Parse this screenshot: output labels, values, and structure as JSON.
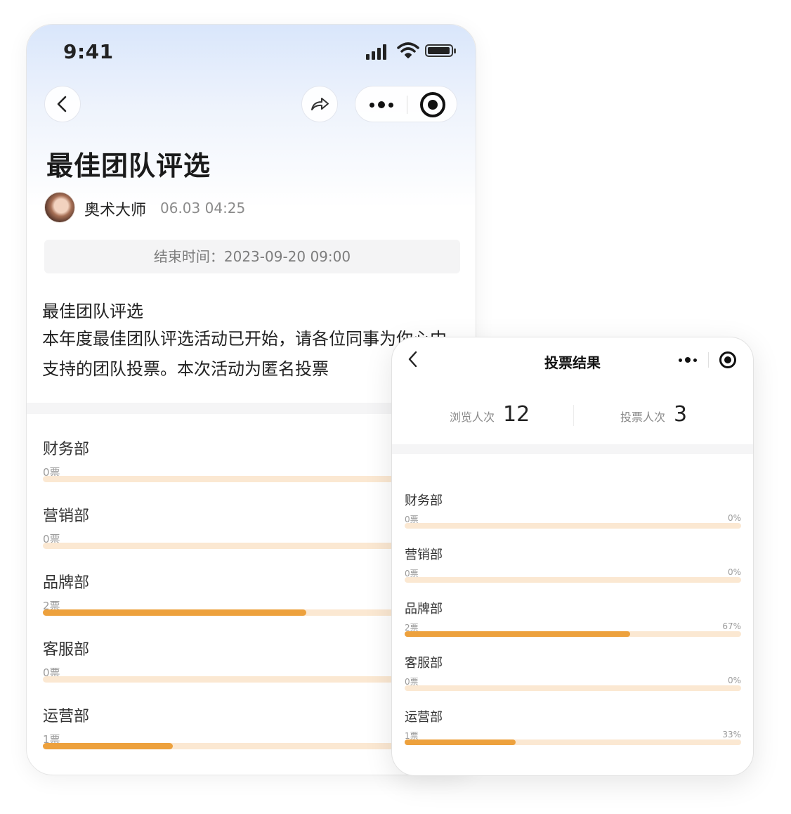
{
  "phone1": {
    "status": {
      "time": "9:41"
    },
    "title": "最佳团队评选",
    "author": "奥术大师",
    "post_time": "06.03 04:25",
    "end_time_label": "结束时间：2023-09-20 09:00",
    "description_title": "最佳团队评选",
    "description_body": "本年度最佳团队评选活动已开始，请各位同事为你心中支持的团队投票。本次活动为匿名投票",
    "options": [
      {
        "name": "财务部",
        "votes": "0票",
        "fraction": 0
      },
      {
        "name": "营销部",
        "votes": "0票",
        "fraction": 0
      },
      {
        "name": "品牌部",
        "votes": "2票",
        "fraction": 0.67
      },
      {
        "name": "客服部",
        "votes": "0票",
        "fraction": 0
      },
      {
        "name": "运营部",
        "votes": "1票",
        "fraction": 0.33
      }
    ]
  },
  "phone2": {
    "title": "投票结果",
    "stats": {
      "views_label": "浏览人次",
      "views_value": "12",
      "votes_label": "投票人次",
      "votes_value": "3"
    },
    "options": [
      {
        "name": "财务部",
        "votes": "0票",
        "percent": "0%",
        "fraction": 0
      },
      {
        "name": "营销部",
        "votes": "0票",
        "percent": "0%",
        "fraction": 0
      },
      {
        "name": "品牌部",
        "votes": "2票",
        "percent": "67%",
        "fraction": 0.67
      },
      {
        "name": "客服部",
        "votes": "0票",
        "percent": "0%",
        "fraction": 0
      },
      {
        "name": "运营部",
        "votes": "1票",
        "percent": "33%",
        "fraction": 0.33
      }
    ]
  },
  "icons": {
    "back": "back-arrow-icon",
    "share": "share-icon",
    "more": "more-dots-icon",
    "target": "record-target-icon",
    "signal": "signal-icon",
    "wifi": "wifi-icon",
    "battery": "battery-icon"
  },
  "colors": {
    "accent": "#eda13d",
    "track": "#fbe8d2",
    "header_gradient_top": "#d9e6fb"
  }
}
